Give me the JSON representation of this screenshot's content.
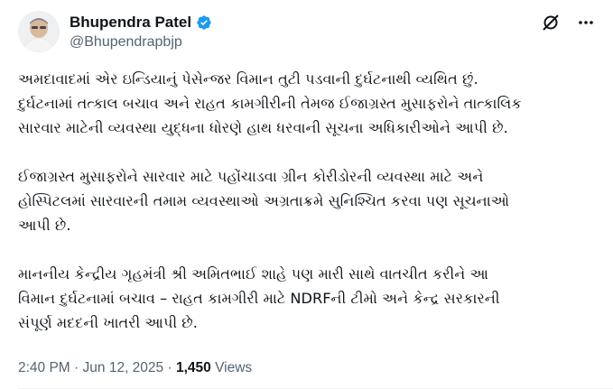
{
  "author": {
    "display_name": "Bhupendra Patel",
    "handle": "@Bhupendrapbjp",
    "verified_color": "#1d9bf0"
  },
  "icons": {
    "grok": "grok-icon",
    "more": "more-icon",
    "verified": "verified-badge-icon"
  },
  "tweet": {
    "paragraphs": [
      "અમદાવાદમાં એર ઇન્ડિયાનું પેસેન્જર વિમાન તુટી પડવાની દુર્ઘટનાથી વ્યથિત છું.\nદુર્ઘટનામાં તત્કાલ બચાવ અને રાહત કામગીરીની તેમજ ઈજાગ્રસ્ત મુસાફરોને તાત્કાલિક\nસારવાર માટેની વ્યવસ્થા યુદ્ધના ધોરણે હાથ ધરવાની સૂચના અધિકારીઓને આપી છે.",
      "ઈજાગ્રસ્ત મુસાફરોને સારવાર માટે પહોંચાડવા ગ્રીન કોરીડોરની વ્યવસ્થા માટે અને\nહોસ્પિટલમાં સારવારની તમામ વ્યવસ્થાઓ અગ્રતાક્રમે સુનિશ્ચિત કરવા પણ સૂચનાઓ\nઆપી છે.",
      "માનનીય કેન્દ્રીય ગૃહમંત્રી શ્રી અમિતભાઈ શાહે પણ મારી સાથે વાતચીત કરીને આ\nવિમાન દુર્ઘટનામાં બચાવ – રાહત કામગીરી માટે NDRFની ટીમો અને કેન્દ્ર સરકારની\nસંપૂર્ણ મદદની ખાતરી આપી છે."
    ]
  },
  "meta": {
    "time": "2:40 PM",
    "separator": "·",
    "date": "Jun 12, 2025",
    "views_count": "1,450",
    "views_label": "Views"
  }
}
